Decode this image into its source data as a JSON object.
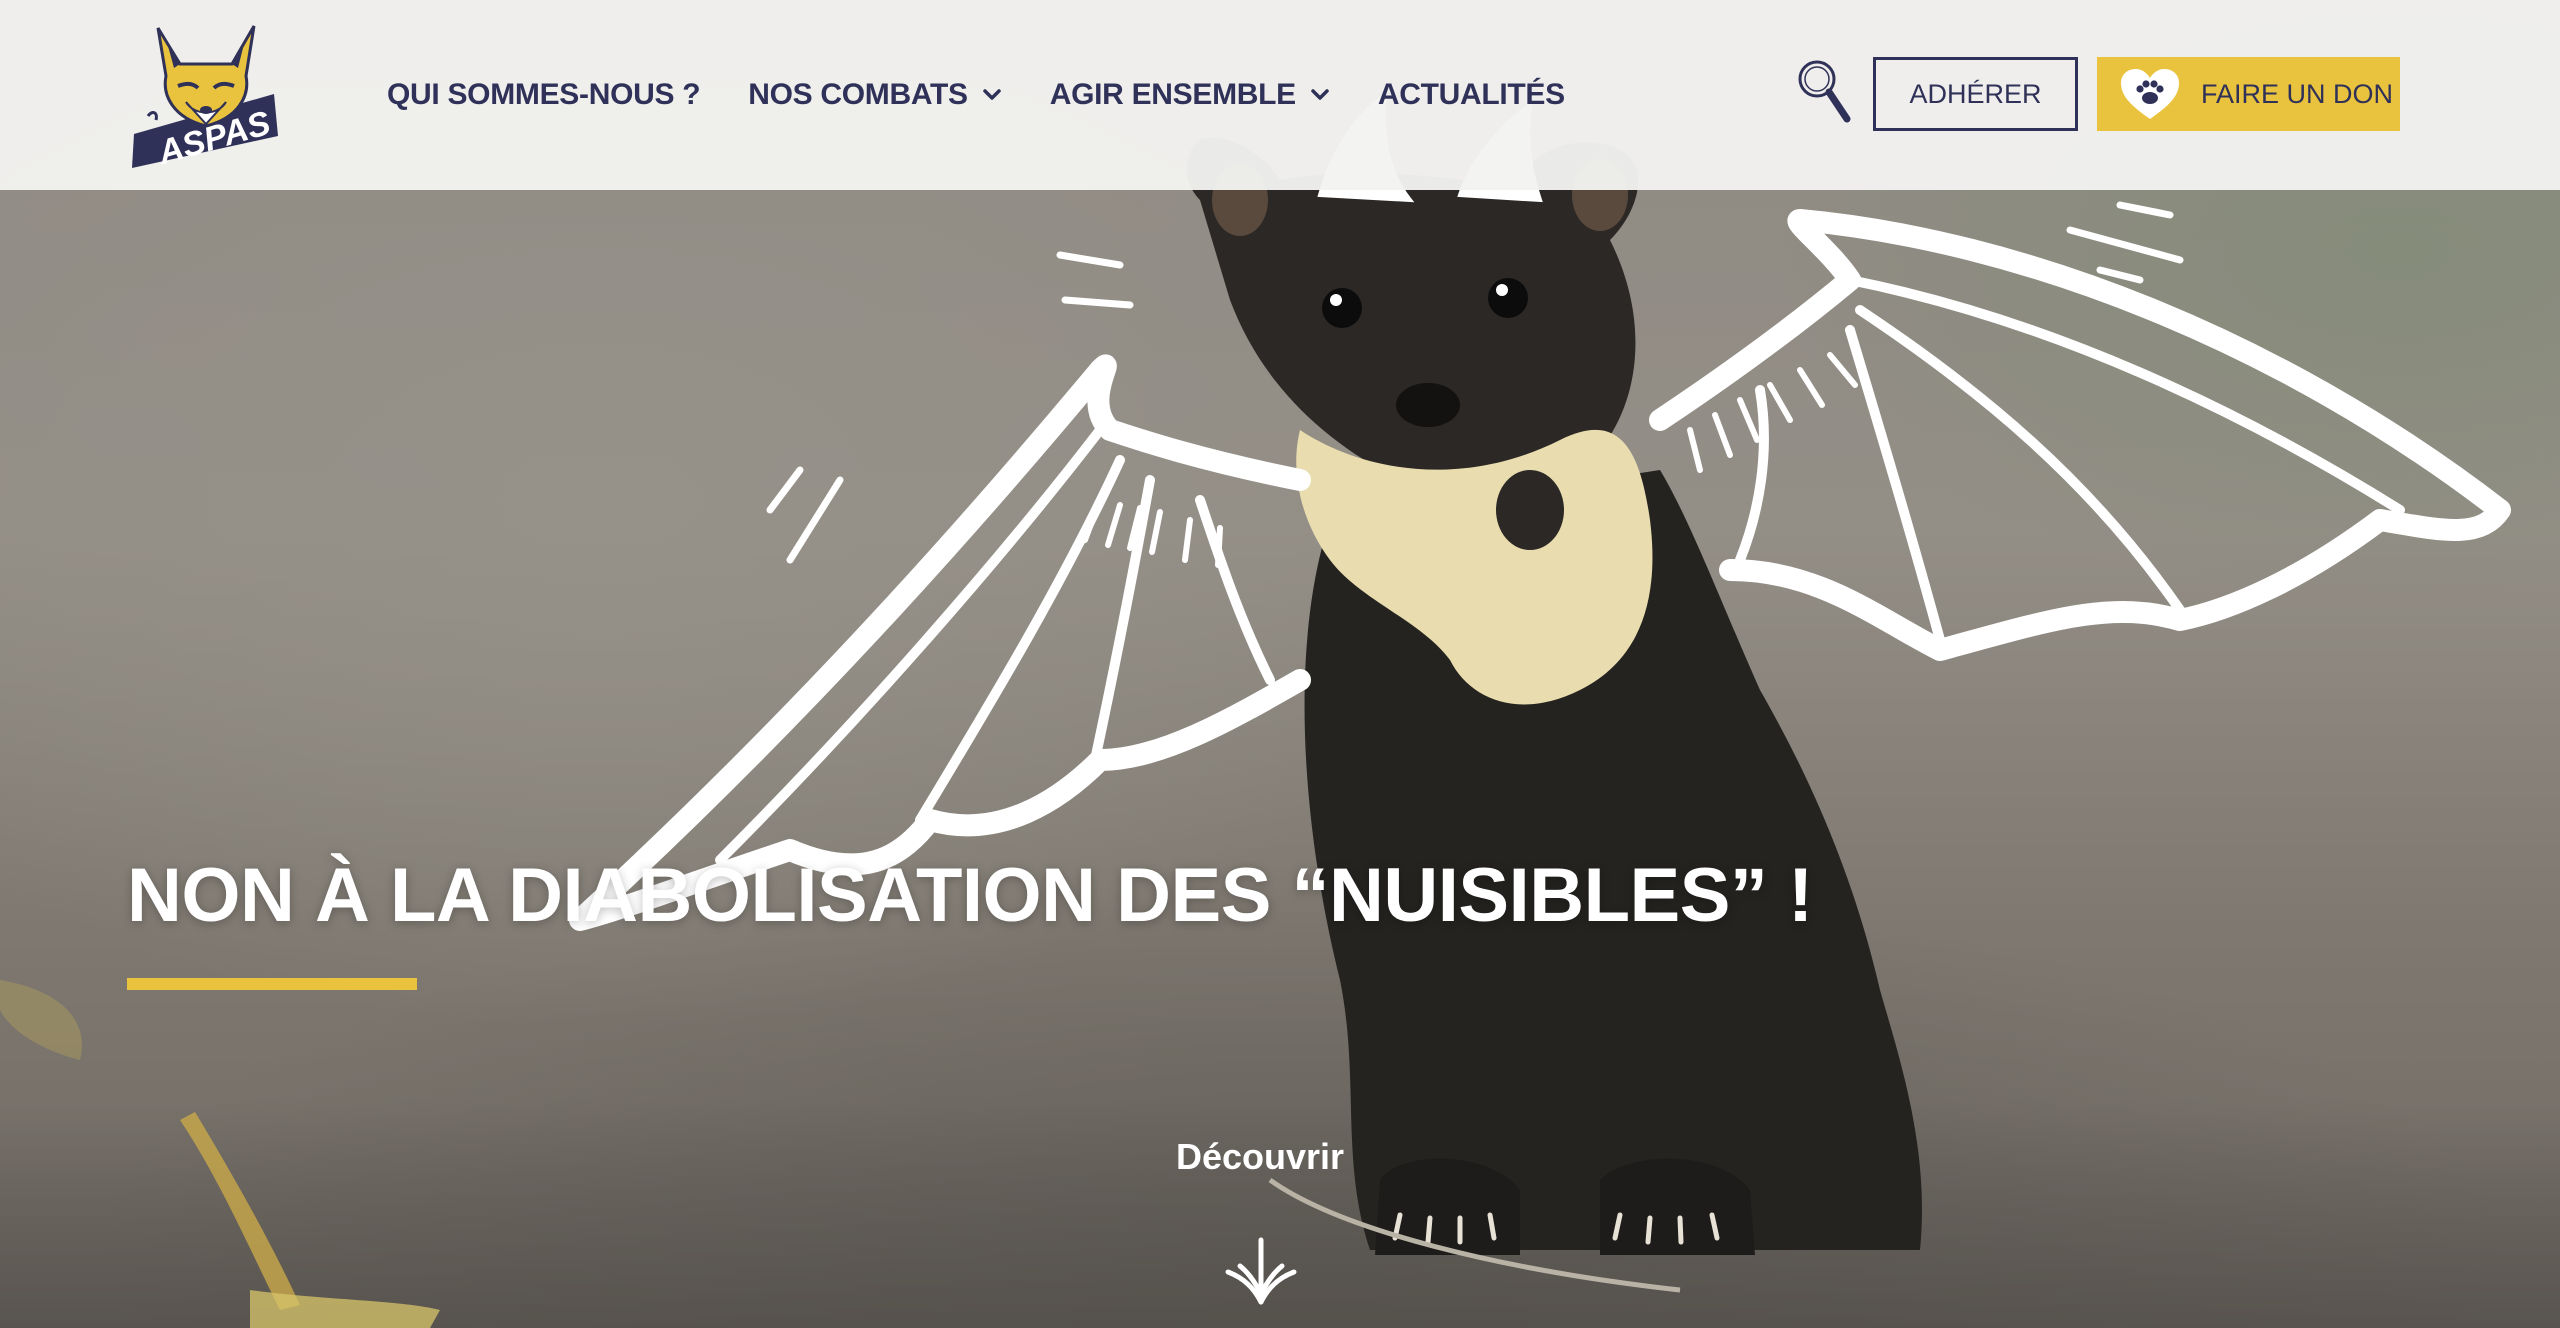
{
  "header": {
    "logo_alt": "ASPAS",
    "nav": [
      {
        "label": "QUI SOMMES-NOUS ?",
        "has_dropdown": false
      },
      {
        "label": "NOS COMBATS",
        "has_dropdown": true
      },
      {
        "label": "AGIR ENSEMBLE",
        "has_dropdown": true
      },
      {
        "label": "ACTUALITÉS",
        "has_dropdown": false
      }
    ],
    "search_icon": "search-icon",
    "adherer_label": "ADHÉRER",
    "don_label": "FAIRE UN DON"
  },
  "hero": {
    "title": "NON À LA DIABOLISATION DES “NUISIBLES” !",
    "discover_label": "Découvrir"
  },
  "colors": {
    "navy": "#2f3158",
    "accent_yellow": "#e9c33e",
    "header_bg": "#f2f2f0",
    "white": "#ffffff"
  }
}
